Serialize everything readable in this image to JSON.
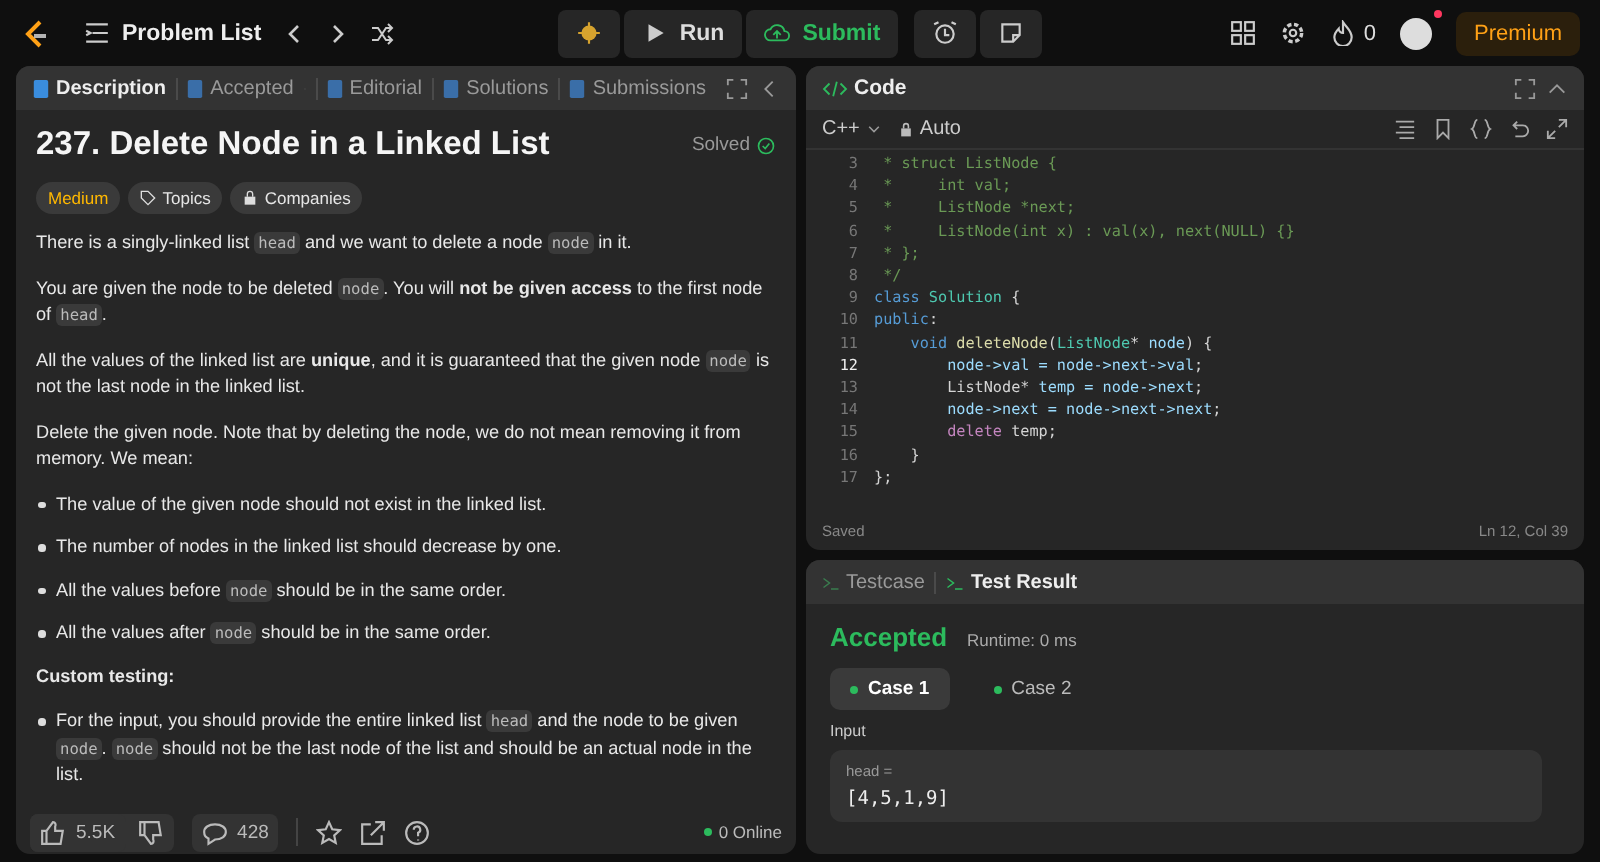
{
  "topbar": {
    "title": "Problem List",
    "run": "Run",
    "submit": "Submit",
    "streak": "0",
    "premium": "Premium",
    "notification": true
  },
  "left_panel": {
    "tabs": [
      {
        "label": "Description",
        "selected": true,
        "closable": false
      },
      {
        "label": "Accepted",
        "selected": false,
        "closable": true
      },
      {
        "label": "Editorial",
        "selected": false,
        "closable": false
      },
      {
        "label": "Solutions",
        "selected": false,
        "closable": false
      },
      {
        "label": "Submissions",
        "selected": false,
        "closable": false
      }
    ],
    "title": "237. Delete Node in a Linked List",
    "status": "Solved",
    "tags": [
      {
        "label": "Medium",
        "kind": "difficulty"
      },
      {
        "label": "Topics",
        "kind": "topics"
      },
      {
        "label": "Companies",
        "kind": "companies"
      }
    ],
    "paragraphs": [
      {
        "kind": "text",
        "parts": [
          {
            "kind": "plain",
            "text": "There is a singly-linked list "
          },
          {
            "kind": "code",
            "text": "head"
          },
          {
            "kind": "plain",
            "text": " and we want to delete a node "
          },
          {
            "kind": "code",
            "text": "node"
          },
          {
            "kind": "plain",
            "text": " in it."
          }
        ]
      },
      {
        "kind": "text",
        "parts": [
          {
            "kind": "plain",
            "text": "You are given the node to be deleted "
          },
          {
            "kind": "code",
            "text": "node"
          },
          {
            "kind": "plain",
            "text": ". You will "
          },
          {
            "kind": "bold",
            "text": "not be given access"
          },
          {
            "kind": "plain",
            "text": " to the first node of "
          },
          {
            "kind": "code",
            "text": "head"
          },
          {
            "kind": "plain",
            "text": "."
          }
        ]
      },
      {
        "kind": "text",
        "parts": [
          {
            "kind": "plain",
            "text": "All the values of the linked list are "
          },
          {
            "kind": "bold",
            "text": "unique"
          },
          {
            "kind": "plain",
            "text": ", and it is guaranteed that the given node "
          },
          {
            "kind": "code",
            "text": "node"
          },
          {
            "kind": "plain",
            "text": " is not the last node in the linked list."
          }
        ]
      },
      {
        "kind": "text",
        "parts": [
          {
            "kind": "plain",
            "text": "Delete the given node. Note that by deleting the node, we do not mean removing it from memory. We mean:"
          }
        ]
      },
      {
        "kind": "bullet",
        "parts": [
          {
            "kind": "plain",
            "text": "The value of the given node should not exist in the linked list."
          }
        ]
      },
      {
        "kind": "bullet",
        "parts": [
          {
            "kind": "plain",
            "text": "The number of nodes in the linked list should decrease by one."
          }
        ]
      },
      {
        "kind": "bullet",
        "parts": [
          {
            "kind": "plain",
            "text": "All the values before "
          },
          {
            "kind": "code",
            "text": "node"
          },
          {
            "kind": "plain",
            "text": " should be in the same order."
          }
        ]
      },
      {
        "kind": "bullet",
        "parts": [
          {
            "kind": "plain",
            "text": "All the values after "
          },
          {
            "kind": "code",
            "text": "node"
          },
          {
            "kind": "plain",
            "text": " should be in the same order."
          }
        ]
      },
      {
        "kind": "heading",
        "parts": [
          {
            "kind": "plain",
            "text": "Custom testing:"
          }
        ]
      },
      {
        "kind": "bullet",
        "parts": [
          {
            "kind": "plain",
            "text": "For the input, you should provide the entire linked list "
          },
          {
            "kind": "code",
            "text": "head"
          },
          {
            "kind": "plain",
            "text": " and the node to be given "
          },
          {
            "kind": "code",
            "text": "node"
          },
          {
            "kind": "plain",
            "text": ". "
          },
          {
            "kind": "code",
            "text": "node"
          },
          {
            "kind": "plain",
            "text": " should not be the last node of the list and should be an actual node in the list."
          }
        ]
      }
    ],
    "footer": {
      "likes": "5.5K",
      "comments": "428",
      "online": "0 Online"
    }
  },
  "code_panel": {
    "title": "Code",
    "language": "C++",
    "mode": "Auto",
    "lines": [
      {
        "num": "3",
        "current": false,
        "tokens": [
          {
            "kind": "comment",
            "text": " * struct ListNode {"
          }
        ]
      },
      {
        "num": "4",
        "current": false,
        "tokens": [
          {
            "kind": "comment",
            "text": " *     int val;"
          }
        ]
      },
      {
        "num": "5",
        "current": false,
        "tokens": [
          {
            "kind": "comment",
            "text": " *     ListNode *next;"
          }
        ]
      },
      {
        "num": "6",
        "current": false,
        "tokens": [
          {
            "kind": "comment",
            "text": " *     ListNode(int x) : val(x), next(NULL) {}"
          }
        ]
      },
      {
        "num": "7",
        "current": false,
        "tokens": [
          {
            "kind": "comment",
            "text": " * };"
          }
        ]
      },
      {
        "num": "8",
        "current": false,
        "tokens": [
          {
            "kind": "comment",
            "text": " */"
          }
        ]
      },
      {
        "num": "9",
        "current": false,
        "tokens": [
          {
            "kind": "keyword",
            "text": "class"
          },
          {
            "kind": "type",
            "text": " Solution"
          },
          {
            "kind": "plain",
            "text": " {"
          }
        ]
      },
      {
        "num": "10",
        "current": false,
        "tokens": [
          {
            "kind": "keyword",
            "text": "public"
          },
          {
            "kind": "plain",
            "text": ":"
          }
        ]
      },
      {
        "num": "11",
        "current": false,
        "tokens": [
          {
            "kind": "keyword",
            "text": "    void"
          },
          {
            "kind": "func",
            "text": " deleteNode"
          },
          {
            "kind": "plain",
            "text": "("
          },
          {
            "kind": "type",
            "text": "ListNode"
          },
          {
            "kind": "plain",
            "text": "* "
          },
          {
            "kind": "var",
            "text": "node"
          },
          {
            "kind": "plain",
            "text": ") {"
          }
        ]
      },
      {
        "num": "12",
        "current": true,
        "tokens": [
          {
            "kind": "var",
            "text": "        node->val = node->next->val"
          },
          {
            "kind": "plain",
            "text": ";"
          }
        ]
      },
      {
        "num": "13",
        "current": false,
        "tokens": [
          {
            "kind": "plain",
            "text": "        ListNode* "
          },
          {
            "kind": "var",
            "text": "temp = node->next"
          },
          {
            "kind": "plain",
            "text": ";"
          }
        ]
      },
      {
        "num": "14",
        "current": false,
        "tokens": [
          {
            "kind": "var",
            "text": "        node->next = node->next->next"
          },
          {
            "kind": "plain",
            "text": ";"
          }
        ]
      },
      {
        "num": "15",
        "current": false,
        "tokens": [
          {
            "kind": "control",
            "text": "        delete"
          },
          {
            "kind": "plain",
            "text": " temp;"
          }
        ]
      },
      {
        "num": "16",
        "current": false,
        "tokens": [
          {
            "kind": "plain",
            "text": "    }"
          }
        ]
      },
      {
        "num": "17",
        "current": false,
        "tokens": [
          {
            "kind": "plain",
            "text": "};"
          }
        ]
      }
    ],
    "saved": "Saved",
    "cursor": "Ln 12, Col 39"
  },
  "result_panel": {
    "tabs": [
      {
        "label": "Testcase",
        "selected": false
      },
      {
        "label": "Test Result",
        "selected": true
      }
    ],
    "verdict": "Accepted",
    "runtime": "Runtime: 0 ms",
    "cases": [
      {
        "label": "Case 1",
        "selected": true
      },
      {
        "label": "Case 2",
        "selected": false
      }
    ],
    "input_label": "Input",
    "param": "head =",
    "value": "[4,5,1,9]"
  }
}
